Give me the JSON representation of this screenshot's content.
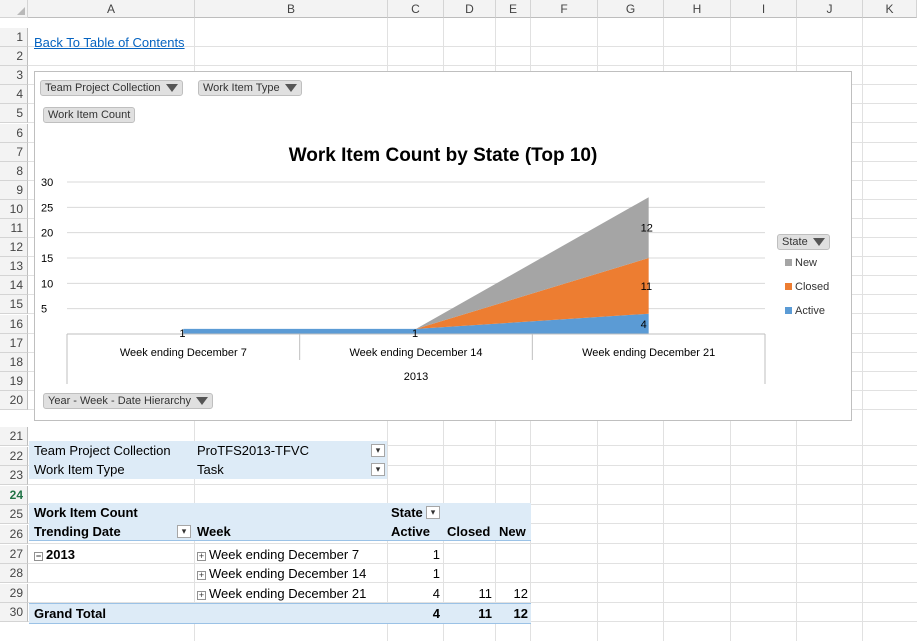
{
  "columns": [
    "A",
    "B",
    "C",
    "D",
    "E",
    "F",
    "G",
    "H",
    "I",
    "J",
    "K"
  ],
  "rows": [
    "1",
    "2",
    "3",
    "4",
    "5",
    "6",
    "7",
    "8",
    "9",
    "10",
    "11",
    "12",
    "13",
    "14",
    "15",
    "16",
    "17",
    "18",
    "19",
    "20",
    "21",
    "22",
    "23",
    "24",
    "25",
    "26",
    "27",
    "28",
    "29",
    "30"
  ],
  "back_link": "Back To Table of Contents",
  "chart": {
    "field_buttons": {
      "team_project_collection": "Team Project Collection",
      "work_item_type": "Work Item Type",
      "work_item_count": "Work Item Count",
      "date_hierarchy": "Year - Week - Date Hierarchy",
      "state": "State"
    },
    "legend_position": "right"
  },
  "chart_data": {
    "type": "area",
    "stacked": true,
    "title": "Work Item Count by State (Top 10)",
    "categories": [
      "Week ending December 7",
      "Week ending December 14",
      "Week ending December 21"
    ],
    "group_label": "2013",
    "ylim": [
      0,
      30
    ],
    "yticks": [
      "30",
      "25",
      "20",
      "15",
      "10",
      "5"
    ],
    "series": [
      {
        "name": "Active",
        "values": [
          1,
          1,
          4
        ],
        "color": "#5b9bd5",
        "labels": [
          "1",
          "1",
          "4"
        ]
      },
      {
        "name": "Closed",
        "values": [
          0,
          0,
          11
        ],
        "color": "#ed7d31",
        "labels": [
          "",
          "",
          "11"
        ]
      },
      {
        "name": "New",
        "values": [
          0,
          0,
          12
        ],
        "color": "#a5a5a5",
        "labels": [
          "",
          "",
          "12"
        ]
      }
    ],
    "legend": [
      "New",
      "Closed",
      "Active"
    ],
    "grid": true
  },
  "filters": {
    "team_project_collection_label": "Team Project Collection",
    "team_project_collection_value": "ProTFS2013-TFVC",
    "work_item_type_label": "Work Item Type",
    "work_item_type_value": "Task"
  },
  "pivot": {
    "values_header": "Work Item Count",
    "state_header": "State",
    "trending_date_header": "Trending Date",
    "week_header": "Week",
    "state_columns": [
      "Active",
      "Closed",
      "New"
    ],
    "year": "2013",
    "rows": [
      {
        "week": "Week ending December 7",
        "active": "1",
        "closed": "",
        "new": ""
      },
      {
        "week": "Week ending December 14",
        "active": "1",
        "closed": "",
        "new": ""
      },
      {
        "week": "Week ending December 21",
        "active": "4",
        "closed": "11",
        "new": "12"
      }
    ],
    "grand_total_label": "Grand Total",
    "grand_total": {
      "active": "4",
      "closed": "11",
      "new": "12"
    }
  }
}
